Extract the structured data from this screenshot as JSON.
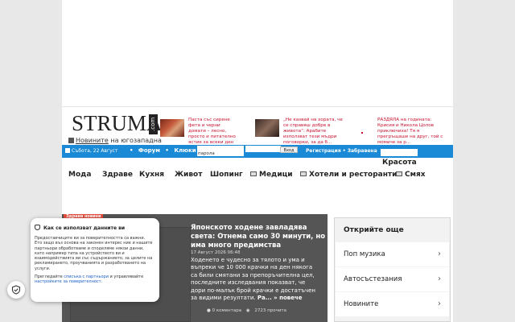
{
  "header": {
    "logo_text": "STRUMA",
    "logo_suffix": ".com",
    "tagline_link": "Новините",
    "tagline_rest": " на югозападна"
  },
  "teasers": [
    {
      "text": "Паста със сирене фета и черни домати – лесно, просто и питателно ястие за всеки ден"
    },
    {
      "text": "„Не казвай на хората, че се справяш добре в живота“: Арабите използват тези мъдри поговорки, за да б..."
    },
    {
      "text": "РАЗДЯЛА на годината: Крисия и Никола Цолов приключиха! Тя я прегръщаше на друг, той с момиче за р..."
    }
  ],
  "topbar": {
    "date": "Събота, 22 Август",
    "links": [
      "Форум",
      "Клюки"
    ],
    "password_label": "парола",
    "login_button": "Вход",
    "register": "Регистрация",
    "forgot": "Забравена"
  },
  "beauty_label": "Красота",
  "nav": {
    "items": [
      "Мода",
      "Здраве",
      "Кухня",
      "Живот",
      "Шопинг",
      "Медици",
      "Хотели и ресторанти",
      "Смях"
    ],
    "icons": {
      "5": "tv-icon",
      "6": "tv-icon",
      "7": "tv-icon"
    }
  },
  "article": {
    "tag": "Здрави новини",
    "title": "Японското ходене завладява света: Отнема само 30 минути, но има много предимства",
    "date": "17 Август 2026 06:48",
    "excerpt": "Ходенето е чудесно за тялото и ума и въпреки че 10 000 крачки на ден някога са били смятани за препоръчителна цел, последните изследвания показват, че дори по-малък брой крачки е достатъчен за видими резултати.",
    "more": "Ра... » повече",
    "comments": "0 коментара",
    "views": "2723 прочита"
  },
  "sidebar": {
    "title": "Открийте още",
    "items": [
      "Поп музика",
      "Автосъстезания",
      "Новините"
    ]
  },
  "consent": {
    "title": "Как се използват данните ви",
    "body": "Предоставчиците ви за поверителността са важни. Ето защо въз основа на законен интерес ние и нашите партньори обработваме и споделяме някои данни, като например типа на устройството ви и взаимодействията ви със съдържанието, за целите на рекламирането, проучванията и разработването на услуги.",
    "footer_prefix": "Прегледайте ",
    "partners_link": "списъка с партньори",
    "footer_mid": " и управлявайте ",
    "settings_link": "настройките за поверителност."
  },
  "colors": {
    "accent_blue": "#1a8ad6",
    "headline_red": "#c8102e",
    "tag_red": "#e74c3c",
    "article_bg": "#555555"
  }
}
